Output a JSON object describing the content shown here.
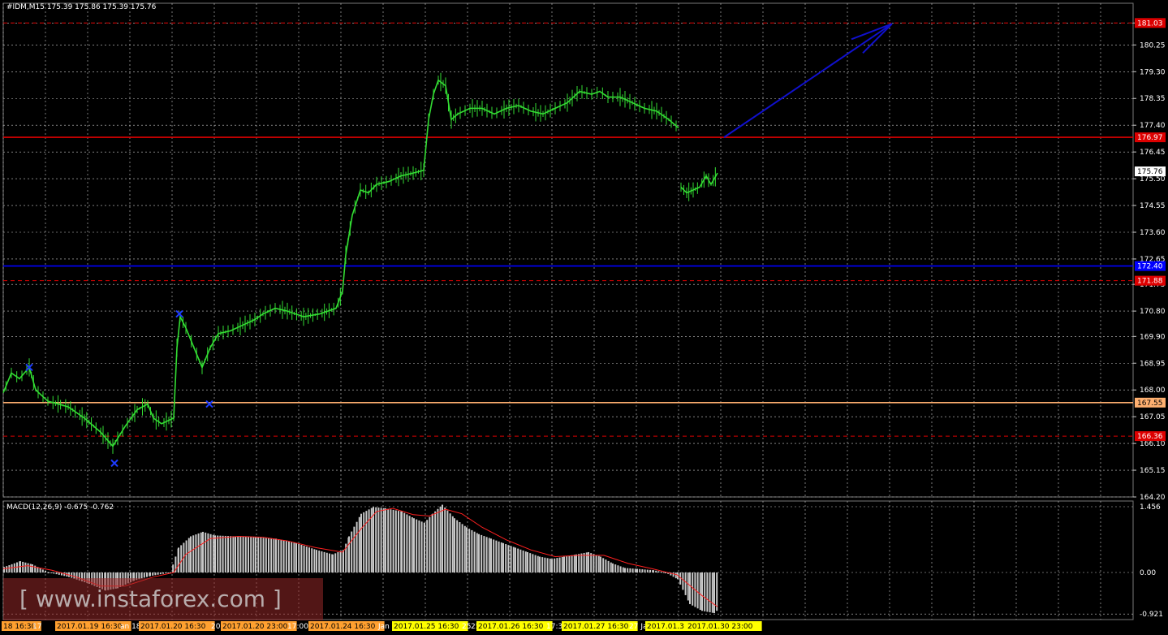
{
  "header": {
    "title": "#IDM,M15  175.39 175.86 175.39 175.76"
  },
  "watermark": {
    "text": "[ www.instaforex.com ]"
  },
  "colors": {
    "bg": "#000000",
    "candle": "#33dd33",
    "grid": "#ffffff",
    "red": "#dd0000",
    "blue": "#0000ff",
    "orange": "#ffb070",
    "macd": "#c8c8c8",
    "signal": "#ff2020",
    "arrow": "#1010cc",
    "marker": "#1e3cff"
  },
  "chart_data": [
    {
      "type": "line",
      "title": "#IDM,M15",
      "ylim": [
        164.2,
        181.5
      ],
      "y_ticks": [
        "181.03",
        "180.25",
        "179.30",
        "178.35",
        "177.40",
        "176.45",
        "175.50",
        "174.55",
        "173.60",
        "172.65",
        "171.75",
        "170.80",
        "169.90",
        "168.95",
        "168.00",
        "167.05",
        "166.10",
        "165.15",
        "164.20"
      ],
      "price_labels": [
        {
          "value": 181.03,
          "text": "181.03",
          "bg": "#dd0000"
        },
        {
          "value": 176.97,
          "text": "176.97",
          "bg": "#dd0000"
        },
        {
          "value": 175.76,
          "text": "175.76",
          "bg": "#ffffff"
        },
        {
          "value": 172.4,
          "text": "172.40",
          "bg": "#0000ff"
        },
        {
          "value": 171.88,
          "text": "171.88",
          "bg": "#dd0000"
        },
        {
          "value": 167.55,
          "text": "167.55",
          "bg": "#ffb070"
        },
        {
          "value": 166.36,
          "text": "166.36",
          "bg": "#dd0000"
        }
      ],
      "hlines": [
        {
          "value": 181.03,
          "style": "dashed",
          "color": "#dd0000"
        },
        {
          "value": 176.97,
          "style": "solid",
          "color": "#dd0000"
        },
        {
          "value": 172.4,
          "style": "solid",
          "color": "#0000ff"
        },
        {
          "value": 171.88,
          "style": "dashed",
          "color": "#dd0000"
        },
        {
          "value": 167.55,
          "style": "solid",
          "color": "#ffb070"
        },
        {
          "value": 166.36,
          "style": "dashed",
          "color": "#dd0000"
        }
      ],
      "price_path": [
        [
          0,
          167.9
        ],
        [
          10,
          168.6
        ],
        [
          20,
          168.4
        ],
        [
          32,
          168.8
        ],
        [
          40,
          168.0
        ],
        [
          55,
          167.6
        ],
        [
          80,
          167.4
        ],
        [
          100,
          167.0
        ],
        [
          120,
          166.5
        ],
        [
          135,
          166.0
        ],
        [
          150,
          166.7
        ],
        [
          165,
          167.3
        ],
        [
          178,
          167.5
        ],
        [
          185,
          167.0
        ],
        [
          195,
          166.8
        ],
        [
          210,
          167.0
        ],
        [
          214,
          169.5
        ],
        [
          218,
          170.6
        ],
        [
          225,
          170.2
        ],
        [
          235,
          169.5
        ],
        [
          245,
          168.8
        ],
        [
          255,
          169.5
        ],
        [
          265,
          170.0
        ],
        [
          280,
          170.1
        ],
        [
          295,
          170.3
        ],
        [
          310,
          170.5
        ],
        [
          320,
          170.7
        ],
        [
          335,
          170.9
        ],
        [
          350,
          170.8
        ],
        [
          370,
          170.6
        ],
        [
          390,
          170.7
        ],
        [
          410,
          170.9
        ],
        [
          418,
          171.5
        ],
        [
          422,
          172.8
        ],
        [
          430,
          174.2
        ],
        [
          440,
          175.1
        ],
        [
          450,
          175.0
        ],
        [
          460,
          175.3
        ],
        [
          475,
          175.4
        ],
        [
          490,
          175.6
        ],
        [
          505,
          175.7
        ],
        [
          518,
          175.8
        ],
        [
          524,
          177.6
        ],
        [
          530,
          178.5
        ],
        [
          536,
          179.0
        ],
        [
          545,
          178.8
        ],
        [
          552,
          177.6
        ],
        [
          560,
          177.8
        ],
        [
          575,
          178.0
        ],
        [
          590,
          178.0
        ],
        [
          605,
          177.8
        ],
        [
          620,
          178.0
        ],
        [
          635,
          178.1
        ],
        [
          650,
          177.9
        ],
        [
          665,
          177.8
        ],
        [
          680,
          178.0
        ],
        [
          695,
          178.2
        ],
        [
          710,
          178.6
        ],
        [
          725,
          178.5
        ],
        [
          735,
          178.6
        ],
        [
          745,
          178.4
        ],
        [
          760,
          178.4
        ],
        [
          775,
          178.2
        ],
        [
          790,
          178.0
        ],
        [
          805,
          177.9
        ],
        [
          820,
          177.6
        ],
        [
          832,
          177.3
        ]
      ],
      "price_path_2": [
        [
          835,
          175.2
        ],
        [
          842,
          175.0
        ],
        [
          850,
          175.1
        ],
        [
          858,
          175.2
        ],
        [
          866,
          175.6
        ],
        [
          872,
          175.3
        ],
        [
          880,
          175.7
        ]
      ],
      "markers": [
        {
          "x": 32,
          "y": 168.8
        },
        {
          "x": 137,
          "y": 165.4
        },
        {
          "x": 217,
          "y": 170.7
        },
        {
          "x": 254,
          "y": 167.5
        }
      ],
      "arrow": {
        "from": [
          888,
          176.97
        ],
        "to": [
          1095,
          181.0
        ]
      }
    },
    {
      "type": "bar",
      "title": "MACD(12,26,9) -0.675 -0.762",
      "ylim": [
        -1.0,
        1.55
      ],
      "y_ticks": [
        "1.456",
        "0.00",
        "-0.921"
      ],
      "bars": [
        [
          0,
          0.12
        ],
        [
          20,
          0.25
        ],
        [
          35,
          0.18
        ],
        [
          55,
          0.0
        ],
        [
          80,
          -0.1
        ],
        [
          105,
          -0.25
        ],
        [
          125,
          -0.4
        ],
        [
          140,
          -0.35
        ],
        [
          160,
          -0.18
        ],
        [
          180,
          -0.08
        ],
        [
          205,
          0.0
        ],
        [
          215,
          0.55
        ],
        [
          230,
          0.8
        ],
        [
          245,
          0.9
        ],
        [
          260,
          0.82
        ],
        [
          285,
          0.8
        ],
        [
          310,
          0.78
        ],
        [
          335,
          0.75
        ],
        [
          360,
          0.65
        ],
        [
          385,
          0.5
        ],
        [
          405,
          0.4
        ],
        [
          418,
          0.5
        ],
        [
          425,
          0.8
        ],
        [
          440,
          1.3
        ],
        [
          455,
          1.45
        ],
        [
          470,
          1.42
        ],
        [
          490,
          1.35
        ],
        [
          505,
          1.2
        ],
        [
          518,
          1.1
        ],
        [
          528,
          1.3
        ],
        [
          540,
          1.5
        ],
        [
          555,
          1.2
        ],
        [
          570,
          1.0
        ],
        [
          585,
          0.85
        ],
        [
          600,
          0.75
        ],
        [
          615,
          0.65
        ],
        [
          630,
          0.55
        ],
        [
          645,
          0.45
        ],
        [
          660,
          0.35
        ],
        [
          675,
          0.3
        ],
        [
          690,
          0.35
        ],
        [
          705,
          0.4
        ],
        [
          720,
          0.45
        ],
        [
          735,
          0.35
        ],
        [
          750,
          0.2
        ],
        [
          765,
          0.1
        ],
        [
          780,
          0.08
        ],
        [
          800,
          0.05
        ],
        [
          815,
          0.0
        ],
        [
          830,
          -0.15
        ],
        [
          845,
          -0.7
        ],
        [
          860,
          -0.85
        ],
        [
          875,
          -0.9
        ],
        [
          880,
          -0.82
        ]
      ],
      "signal": [
        [
          0,
          0.08
        ],
        [
          30,
          0.15
        ],
        [
          60,
          0.05
        ],
        [
          90,
          -0.1
        ],
        [
          120,
          -0.3
        ],
        [
          150,
          -0.3
        ],
        [
          185,
          -0.1
        ],
        [
          210,
          0.0
        ],
        [
          225,
          0.4
        ],
        [
          255,
          0.75
        ],
        [
          290,
          0.8
        ],
        [
          320,
          0.78
        ],
        [
          350,
          0.7
        ],
        [
          385,
          0.55
        ],
        [
          418,
          0.45
        ],
        [
          440,
          0.95
        ],
        [
          460,
          1.35
        ],
        [
          480,
          1.42
        ],
        [
          505,
          1.28
        ],
        [
          525,
          1.25
        ],
        [
          545,
          1.4
        ],
        [
          565,
          1.3
        ],
        [
          590,
          1.0
        ],
        [
          620,
          0.72
        ],
        [
          650,
          0.5
        ],
        [
          680,
          0.35
        ],
        [
          710,
          0.38
        ],
        [
          740,
          0.38
        ],
        [
          770,
          0.2
        ],
        [
          800,
          0.08
        ],
        [
          830,
          -0.05
        ],
        [
          860,
          -0.5
        ],
        [
          880,
          -0.76
        ]
      ]
    }
  ],
  "x_axis": {
    "labels": [
      {
        "x": 2,
        "text": "18 16:30",
        "bg": "#ffa030"
      },
      {
        "x": 38,
        "text": "17",
        "bg": ""
      },
      {
        "x": 68,
        "text": "2017.01.19 16:30",
        "bg": "#ffa030"
      },
      {
        "x": 146,
        "text": "an 18",
        "bg": ""
      },
      {
        "x": 171,
        "text": "2017.01.20 16:30",
        "bg": "#ffa030"
      },
      {
        "x": 258,
        "text": "20",
        "bg": ""
      },
      {
        "x": 272,
        "text": "2017.01.20 23:00",
        "bg": "#ffa030"
      },
      {
        "x": 352,
        "text": "17:00",
        "bg": ""
      },
      {
        "x": 380,
        "text": "2017.01.24 16:30",
        "bg": "#ffa030"
      },
      {
        "x": 464,
        "text": "Jan",
        "bg": ""
      },
      {
        "x": 483,
        "text": "2017.01.25 16:30",
        "bg": "#ffff00"
      },
      {
        "x": 567,
        "text": "25",
        "bg": ""
      },
      {
        "x": 578,
        "text": "25",
        "bg": ""
      },
      {
        "x": 587,
        "text": "2017.01.26 16:30",
        "bg": "#ffff00"
      },
      {
        "x": 671,
        "text": "17:3",
        "bg": ""
      },
      {
        "x": 692,
        "text": "2017.01.27 16:30",
        "bg": "#ffff00"
      },
      {
        "x": 773,
        "text": "27 Jan",
        "bg": ""
      },
      {
        "x": 795,
        "text": "2017.01.3",
        "bg": "#ffff00"
      },
      {
        "x": 845,
        "text": "2017.01.30 23:00",
        "bg": "#ffff00"
      }
    ]
  }
}
